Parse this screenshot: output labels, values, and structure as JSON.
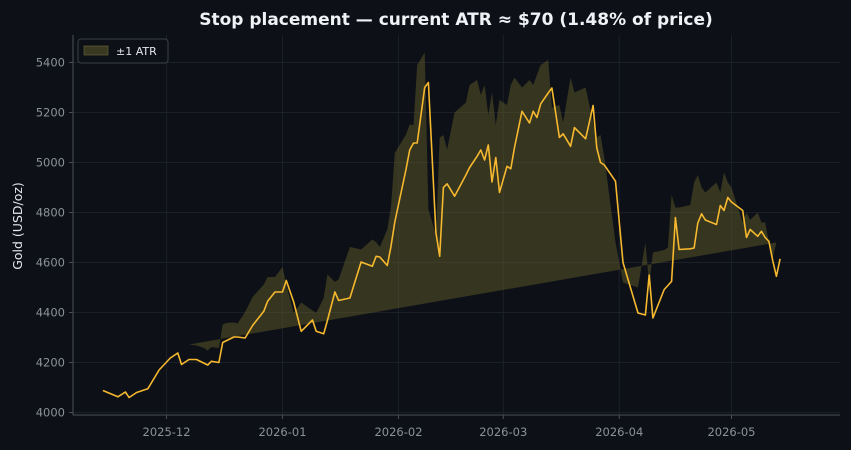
{
  "chart_data": {
    "type": "line",
    "title": "Stop placement — current ATR ≈ $70 (1.48% of price)",
    "ylabel": "Gold (USD/oz)",
    "xlabel": "",
    "ylim": [
      3990,
      5510
    ],
    "xlim": [
      "2025-11-06",
      "2026-05-30"
    ],
    "yticks": [
      4000,
      4200,
      4400,
      4600,
      4800,
      5000,
      5200,
      5400
    ],
    "xticks": [
      "2025-12",
      "2026-01",
      "2026-02",
      "2026-03",
      "2026-04",
      "2026-05"
    ],
    "grid": true,
    "legend": {
      "position": "top-left",
      "entries": [
        "±1 ATR"
      ]
    },
    "colors": {
      "line": "#f5b82e",
      "band": "#5f5a2a",
      "background": "#0d1117"
    },
    "band_half_width_note": "±1 ATR",
    "series": [
      {
        "x": [
          "2025-11-14",
          "2025-11-18",
          "2025-11-20",
          "2025-11-21",
          "2025-11-23",
          "2025-11-26",
          "2025-11-27",
          "2025-11-29",
          "2025-12-02",
          "2025-12-04",
          "2025-12-05",
          "2025-12-07",
          "2025-12-09",
          "2025-12-12",
          "2025-12-13",
          "2025-12-15",
          "2025-12-16",
          "2025-12-19",
          "2025-12-20",
          "2025-12-22",
          "2025-12-24",
          "2025-12-27",
          "2025-12-28",
          "2025-12-30",
          "2026-01-01",
          "2026-01-02",
          "2026-01-04",
          "2026-01-06",
          "2026-01-09",
          "2026-01-10",
          "2026-01-12",
          "2026-01-13",
          "2026-01-15",
          "2026-01-16",
          "2026-01-19",
          "2026-01-22",
          "2026-01-25",
          "2026-01-26",
          "2026-01-27",
          "2026-01-29",
          "2026-01-30",
          "2026-01-31",
          "2026-02-03",
          "2026-02-04",
          "2026-02-05",
          "2026-02-06",
          "2026-02-08",
          "2026-02-09",
          "2026-02-11",
          "2026-02-12",
          "2026-02-13",
          "2026-02-14",
          "2026-02-16",
          "2026-02-19",
          "2026-02-20",
          "2026-02-22",
          "2026-02-23",
          "2026-02-24",
          "2026-02-25",
          "2026-02-26",
          "2026-02-27",
          "2026-02-28",
          "2026-03-02",
          "2026-03-03",
          "2026-03-04",
          "2026-03-06",
          "2026-03-08",
          "2026-03-09",
          "2026-03-10",
          "2026-03-11",
          "2026-03-13",
          "2026-03-14",
          "2026-03-16",
          "2026-03-17",
          "2026-03-19",
          "2026-03-20",
          "2026-03-23",
          "2026-03-25",
          "2026-03-26",
          "2026-03-27",
          "2026-03-28",
          "2026-03-31",
          "2026-04-02",
          "2026-04-06",
          "2026-04-08",
          "2026-04-09",
          "2026-04-10",
          "2026-04-13",
          "2026-04-14",
          "2026-04-15",
          "2026-04-16",
          "2026-04-17",
          "2026-04-20",
          "2026-04-21",
          "2026-04-22",
          "2026-04-23",
          "2026-04-24",
          "2026-04-27",
          "2026-04-28",
          "2026-04-29",
          "2026-04-30",
          "2026-05-01",
          "2026-05-04",
          "2026-05-05",
          "2026-05-06",
          "2026-05-08",
          "2026-05-09",
          "2026-05-10",
          "2026-05-11",
          "2026-05-12",
          "2026-05-13",
          "2026-05-14"
        ],
        "values": [
          4088,
          4063,
          4082,
          4060,
          4080,
          4095,
          4120,
          4170,
          4218,
          4238,
          4192,
          4212,
          4212,
          4190,
          4205,
          4200,
          4280,
          4302,
          4302,
          4298,
          4348,
          4405,
          4445,
          4482,
          4482,
          4528,
          4442,
          4325,
          4370,
          4325,
          4315,
          4368,
          4482,
          4448,
          4458,
          4602,
          4585,
          4625,
          4622,
          4588,
          4665,
          4762,
          4972,
          5050,
          5078,
          5078,
          5300,
          5320,
          4720,
          4625,
          4900,
          4915,
          4865,
          4950,
          4980,
          5025,
          5050,
          5010,
          5070,
          4922,
          5020,
          4880,
          4985,
          4975,
          5060,
          5205,
          5158,
          5205,
          5180,
          5235,
          5278,
          5298,
          5100,
          5115,
          5065,
          5140,
          5095,
          5228,
          5058,
          5000,
          4990,
          4925,
          4600,
          4398,
          4390,
          4550,
          4378,
          4492,
          4508,
          4525,
          4780,
          4652,
          4655,
          4658,
          4758,
          4795,
          4770,
          4752,
          4828,
          4808,
          4860,
          4842,
          4808,
          4700,
          4732,
          4705,
          4725,
          4700,
          4685,
          4608,
          4545,
          4615
        ]
      }
    ],
    "atr_band": {
      "x": [
        "2025-12-07",
        "2025-12-09",
        "2025-12-11",
        "2025-12-12",
        "2025-12-13",
        "2025-12-15",
        "2025-12-16",
        "2025-12-17",
        "2025-12-19",
        "2025-12-20",
        "2025-12-22",
        "2025-12-24",
        "2025-12-27",
        "2025-12-28",
        "2025-12-30",
        "2026-01-01",
        "2026-01-02",
        "2026-01-04",
        "2026-01-06",
        "2026-01-09",
        "2026-01-10",
        "2026-01-12",
        "2026-01-13",
        "2026-01-15",
        "2026-01-16",
        "2026-01-19",
        "2026-01-22",
        "2026-01-25",
        "2026-01-26",
        "2026-01-27",
        "2026-01-29",
        "2026-01-30",
        "2026-01-31",
        "2026-02-03",
        "2026-02-04",
        "2026-02-05",
        "2026-02-06",
        "2026-02-08",
        "2026-02-09",
        "2026-02-11",
        "2026-02-12",
        "2026-02-13",
        "2026-02-14",
        "2026-02-16",
        "2026-02-19",
        "2026-02-20",
        "2026-02-22",
        "2026-02-23",
        "2026-02-24",
        "2026-02-25",
        "2026-02-26",
        "2026-02-27",
        "2026-02-28",
        "2026-03-02",
        "2026-03-03",
        "2026-03-04",
        "2026-03-06",
        "2026-03-08",
        "2026-03-09",
        "2026-03-10",
        "2026-03-11",
        "2026-03-13",
        "2026-03-14",
        "2026-03-16",
        "2026-03-17",
        "2026-03-19",
        "2026-03-20",
        "2026-03-23",
        "2026-03-25",
        "2026-03-26",
        "2026-03-27",
        "2026-03-28",
        "2026-03-31",
        "2026-04-02",
        "2026-04-06",
        "2026-04-08",
        "2026-04-09",
        "2026-04-10",
        "2026-04-13",
        "2026-04-14",
        "2026-04-15",
        "2026-04-16",
        "2026-04-17",
        "2026-04-20",
        "2026-04-21",
        "2026-04-22",
        "2026-04-23",
        "2026-04-24",
        "2026-04-27",
        "2026-04-28",
        "2026-04-29",
        "2026-04-30",
        "2026-05-01",
        "2026-05-04",
        "2026-05-05",
        "2026-05-06",
        "2026-05-08",
        "2026-05-09",
        "2026-05-10",
        "2026-05-11",
        "2026-05-12",
        "2026-05-13",
        "2026-05-14"
      ],
      "upper": [
        4272,
        4268,
        4258,
        4248,
        4262,
        4258,
        4352,
        4358,
        4360,
        4356,
        4402,
        4462,
        4512,
        4542,
        4542,
        4582,
        4512,
        4398,
        4440,
        4408,
        4398,
        4458,
        4552,
        4522,
        4532,
        4662,
        4652,
        4692,
        4682,
        4662,
        4732,
        4822,
        5038,
        5112,
        5152,
        5150,
        5390,
        5440,
        4812,
        4712,
        5100,
        5110,
        5052,
        5200,
        5240,
        5310,
        5330,
        5270,
        5310,
        5190,
        5280,
        5150,
        5250,
        5230,
        5310,
        5340,
        5300,
        5330,
        5310,
        5350,
        5390,
        5410,
        5220,
        5230,
        5160,
        5340,
        5280,
        5300,
        5160,
        5100,
        5110,
        5020,
        4680,
        4520,
        4500,
        4680,
        4510,
        4640,
        4650,
        4660,
        4870,
        4820,
        4820,
        4830,
        4920,
        4950,
        4900,
        4880,
        4920,
        4880,
        4960,
        4920,
        4900,
        4760,
        4800,
        4770,
        4800,
        4760,
        4760,
        4680,
        4620,
        4680
      ]
    }
  }
}
